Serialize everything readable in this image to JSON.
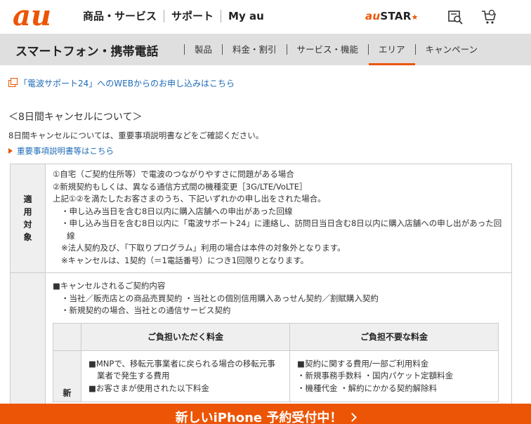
{
  "header": {
    "logo_text": "au",
    "nav": [
      "商品・サービス",
      "サポート",
      "My au"
    ],
    "austar_prefix": "au",
    "austar_label": "STAR",
    "austar_star": "★",
    "icons": [
      "search-book-icon",
      "cart-icon"
    ]
  },
  "category": {
    "title": "スマートフォン・携帯電話",
    "items": [
      "製品",
      "料金・割引",
      "サービス・機能",
      "エリア",
      "キャンペーン"
    ],
    "active_index": 3
  },
  "content": {
    "ext_link": "「電波サポート24」へのWEBからのお申し込みはこちら",
    "section_title": "＜8日間キャンセルについて＞",
    "section_desc": "8日間キャンセルについては、重要事項説明書などをご確認ください。",
    "arrow_link": "重要事項説明書等はこちら",
    "row1": {
      "header": "適用対象",
      "lines": [
        "①自宅（ご契約住所等）で電波のつながりやすさに問題がある場合",
        "②新規契約もしくは、異なる通信方式間の機種変更［3G/LTE/VoLTE］",
        "上記①②を満たしたお客さまのうち、下記いずれかの申し出をされた場合。",
        "・申し込み当日を含む8日以内に購入店舗への申出があった回線",
        "・申し込み当日を含む8日以内に「電波サポート24」に連絡し、訪問日当日含む8日以内に購入店舗への申し出があった回",
        "線",
        "※法人契約及び、「下取りプログラム」利用の場合は本件の対象外となります。",
        "※キャンセルは、1契約（＝1電話番号）につき1回限りとなります。"
      ]
    },
    "row2": {
      "lines": [
        "■キャンセルされるご契約内容",
        "・当社／販売店との商品売買契約 ・当社との個別信用購入あっせん契約／割賦購入契約",
        "・新規契約の場合、当社との通信サービス契約"
      ],
      "inner": {
        "col1_header": "ご負担いただく料金",
        "col2_header": "ご負担不要な料金",
        "row_label": "新",
        "col1_lines": [
          "■MNPで、移転元事業者に戻られる場合の移転元事",
          "業者で発生する費用",
          "■お客さまが使用された以下料金"
        ],
        "col2_lines": [
          "■契約に関する費用/一部ご利用料金",
          "・新規事務手数料 ・国内パケット定額料金",
          "・機種代金 ・解約にかかる契約解除料"
        ]
      }
    }
  },
  "banner": {
    "text": "新しいiPhone 予約受付中！"
  },
  "colors": {
    "brand": "#eb5505",
    "link": "#1e6bb8",
    "category_bg": "#dfdfdf"
  }
}
